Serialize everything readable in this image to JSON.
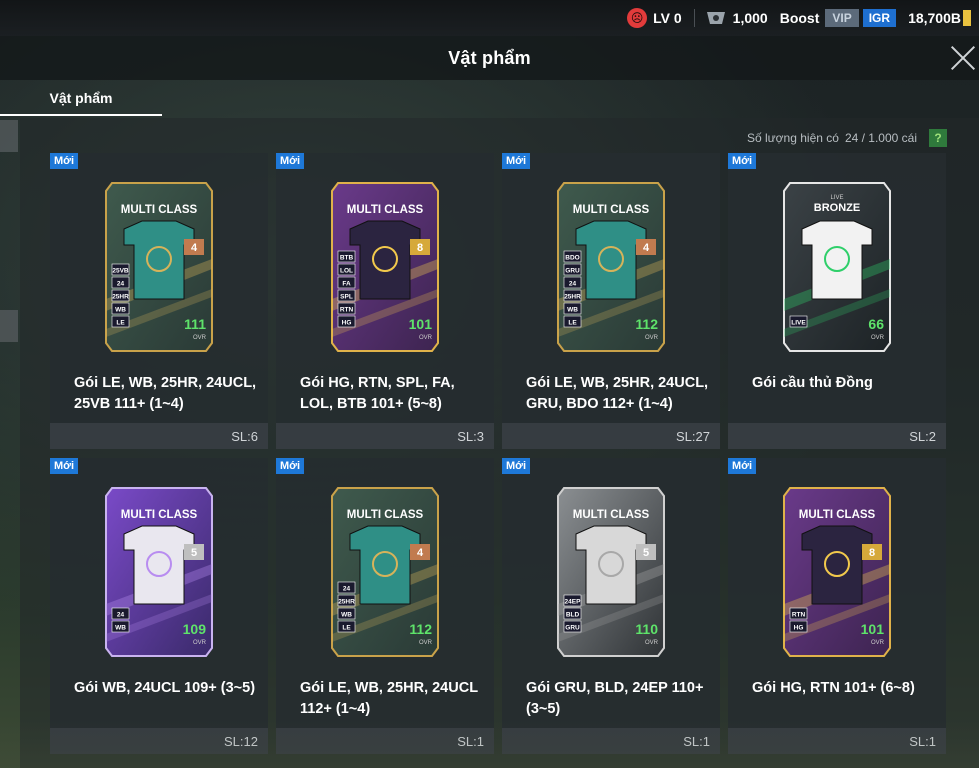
{
  "topbar": {
    "level": "LV 0",
    "coins": "1,000",
    "boost": "Boost",
    "vip": "VIP",
    "igr": "IGR",
    "bp": "18,700B"
  },
  "title": "Vật phẩm",
  "tab": "Vật phẩm",
  "count": {
    "label": "Số lượng hiện có",
    "value": "24 / 1.000 cái",
    "help": "?"
  },
  "new_badge": "Mới",
  "cards": [
    {
      "name": "Gói LE, WB, 25HR, 24UCL, 25VB 111+ (1~4)",
      "sl": "SL:6",
      "ovr": "111",
      "grade": "4",
      "theme": "teal",
      "class_label": "MULTI CLASS",
      "tags": [
        "25VB",
        "24",
        "25HR",
        "WB",
        "LE"
      ]
    },
    {
      "name": "Gói HG, RTN, SPL, FA, LOL, BTB 101+ (5~8)",
      "sl": "SL:3",
      "ovr": "101",
      "grade": "8",
      "theme": "purple",
      "class_label": "MULTI CLASS",
      "tags": [
        "BTB",
        "LOL",
        "FA",
        "SPL",
        "RTN",
        "HG"
      ]
    },
    {
      "name": "Gói LE, WB, 25HR, 24UCL, GRU, BDO 112+ (1~4)",
      "sl": "SL:27",
      "ovr": "112",
      "grade": "4",
      "theme": "teal",
      "class_label": "MULTI CLASS",
      "tags": [
        "BDO",
        "GRU",
        "24",
        "25HR",
        "WB",
        "LE"
      ]
    },
    {
      "name": "Gói cầu thủ Đồng",
      "sl": "SL:2",
      "ovr": "66",
      "grade": "",
      "theme": "live",
      "class_label": "BRONZE",
      "sub_label": "LIVE",
      "tags": [
        "LIVE"
      ]
    },
    {
      "name": "Gói WB, 24UCL 109+ (3~5)",
      "sl": "SL:12",
      "ovr": "109",
      "grade": "5",
      "theme": "violet",
      "class_label": "MULTI CLASS",
      "tags": [
        "24",
        "WB"
      ]
    },
    {
      "name": "Gói LE, WB, 25HR, 24UCL 112+ (1~4)",
      "sl": "SL:1",
      "ovr": "112",
      "grade": "4",
      "theme": "teal",
      "class_label": "MULTI CLASS",
      "tags": [
        "24",
        "25HR",
        "WB",
        "LE"
      ]
    },
    {
      "name": "Gói GRU, BLD, 24EP 110+ (3~5)",
      "sl": "SL:1",
      "ovr": "110",
      "grade": "5",
      "theme": "silver",
      "class_label": "MULTI CLASS",
      "tags": [
        "24EP",
        "BLD",
        "GRU"
      ]
    },
    {
      "name": "Gói HG, RTN 101+ (6~8)",
      "sl": "SL:1",
      "ovr": "101",
      "grade": "8",
      "theme": "purple",
      "class_label": "MULTI CLASS",
      "tags": [
        "RTN",
        "HG"
      ]
    }
  ],
  "ovr_label": "OVR",
  "colors": {
    "accent_blue": "#1e78d8",
    "ovr_green": "#5ee36a",
    "help_green": "#2f7a3c"
  }
}
